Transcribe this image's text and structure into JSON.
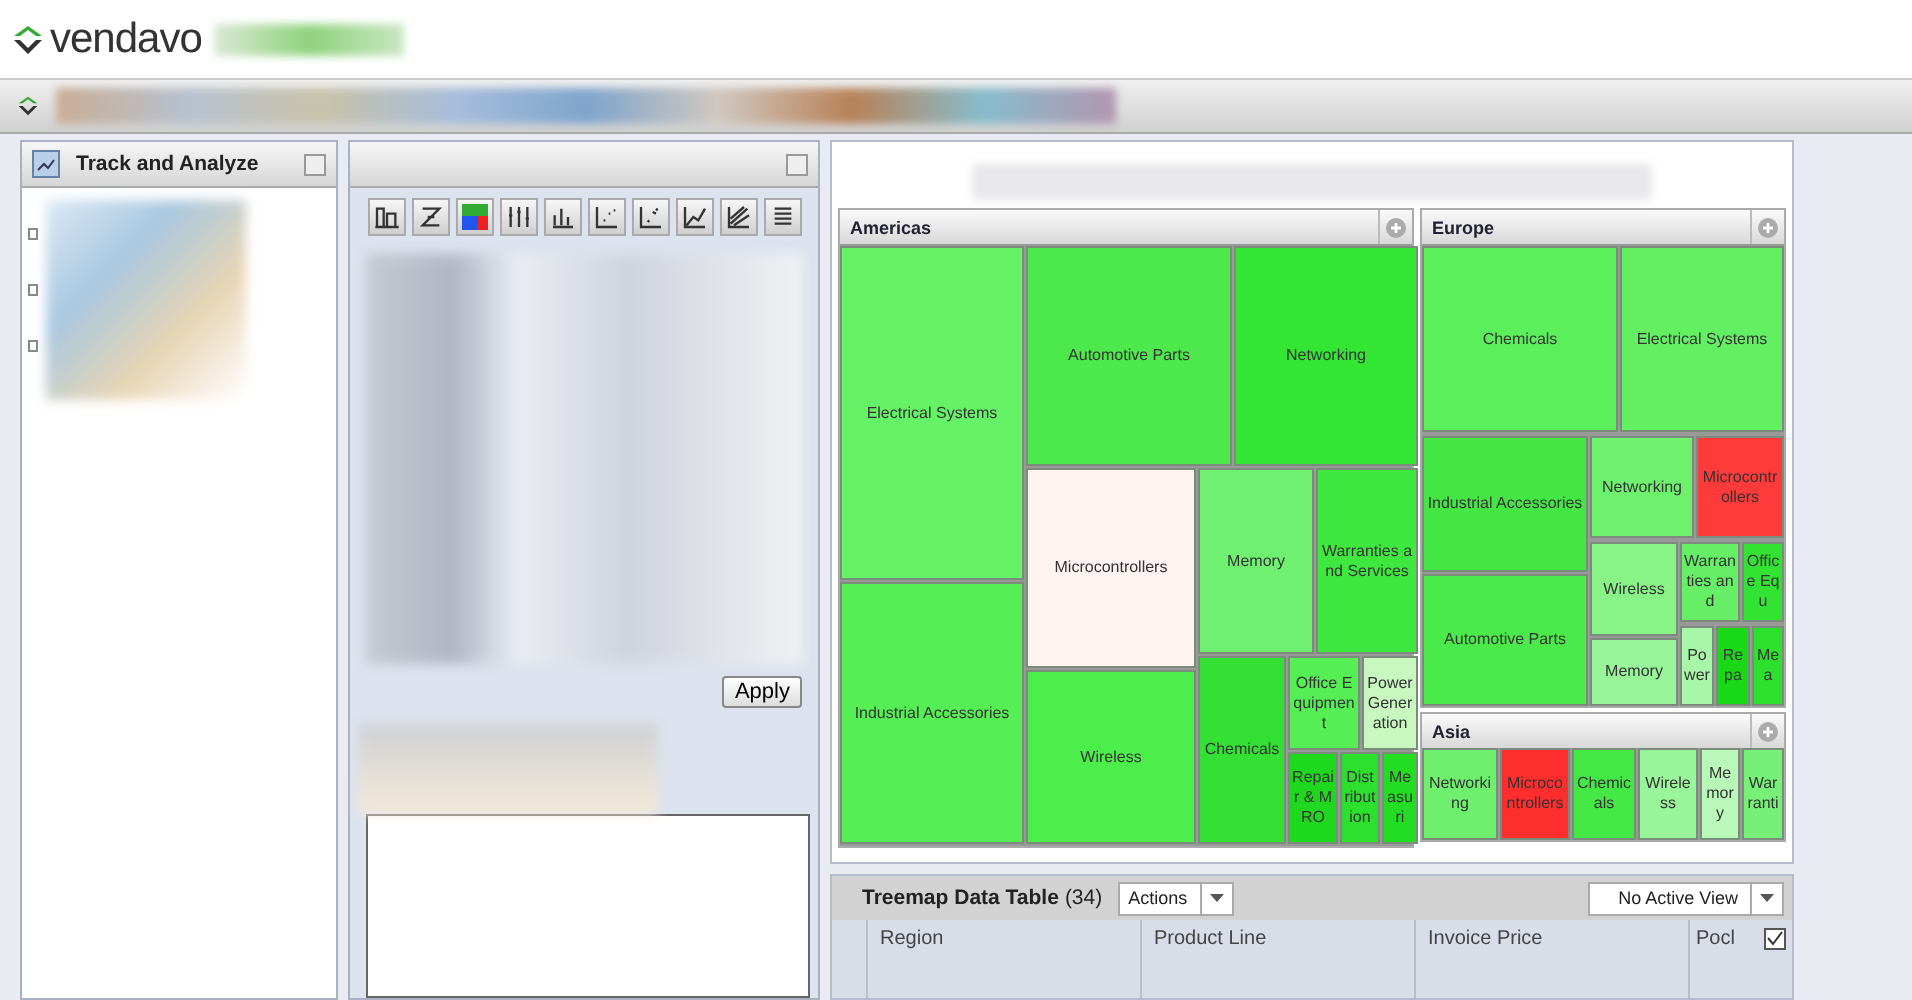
{
  "app": {
    "logo": "vendavo"
  },
  "left_panel": {
    "title": "Track and Analyze"
  },
  "middle_panel": {
    "apply_button": "Apply"
  },
  "treemap": {
    "regions": [
      {
        "name": "Americas",
        "tiles": [
          {
            "label": "Electrical Systems",
            "color": "#66f266"
          },
          {
            "label": "Industrial Accessories",
            "color": "#55ee55"
          },
          {
            "label": "Automotive Parts",
            "color": "#4ce84c"
          },
          {
            "label": "Networking",
            "color": "#33e633"
          },
          {
            "label": "Microcontrollers",
            "color": "#fdf3f1"
          },
          {
            "label": "Memory",
            "color": "#70f070"
          },
          {
            "label": "Warranties and Services",
            "color": "#3ee83e"
          },
          {
            "label": "Wireless",
            "color": "#4cee4c"
          },
          {
            "label": "Chemicals",
            "color": "#33e033"
          },
          {
            "label": "Office Equipment",
            "color": "#55ee55"
          },
          {
            "label": "Power Generation",
            "color": "#c8f7c0"
          },
          {
            "label": "Repair & MRO",
            "color": "#1ed81e"
          },
          {
            "label": "Distribution",
            "color": "#2ee02e"
          },
          {
            "label": "Measuri",
            "color": "#22dd22"
          }
        ]
      },
      {
        "name": "Europe",
        "tiles": [
          {
            "label": "Chemicals",
            "color": "#5cef5c"
          },
          {
            "label": "Electrical Systems",
            "color": "#62f062"
          },
          {
            "label": "Industrial Accessories",
            "color": "#44e644"
          },
          {
            "label": "Automotive Parts",
            "color": "#4aea4a"
          },
          {
            "label": "Networking",
            "color": "#6ef26e"
          },
          {
            "label": "Microcontrollers",
            "color": "#ff3a3a"
          },
          {
            "label": "Wireless",
            "color": "#88f488"
          },
          {
            "label": "Memory",
            "color": "#99f599"
          },
          {
            "label": "Warranties and",
            "color": "#66ef66"
          },
          {
            "label": "Office Equ",
            "color": "#33e333"
          },
          {
            "label": "Power",
            "color": "#a8f6a8"
          },
          {
            "label": "Repa",
            "color": "#18d818"
          },
          {
            "label": "Mea",
            "color": "#2ee02e"
          }
        ]
      },
      {
        "name": "Asia",
        "tiles": [
          {
            "label": "Networking",
            "color": "#6ef06e"
          },
          {
            "label": "Microcontrollers",
            "color": "#ff2e2e"
          },
          {
            "label": "Chemicals",
            "color": "#44e844"
          },
          {
            "label": "Wireless",
            "color": "#99f599"
          },
          {
            "label": "Memory",
            "color": "#b8f8b8"
          },
          {
            "label": "Warranti",
            "color": "#77f077"
          }
        ]
      }
    ]
  },
  "data_table": {
    "title": "Treemap Data Table",
    "count": "(34)",
    "actions": "Actions",
    "view": "No Active View",
    "columns": [
      "Region",
      "Product Line",
      "Invoice Price",
      "Pocl"
    ]
  }
}
